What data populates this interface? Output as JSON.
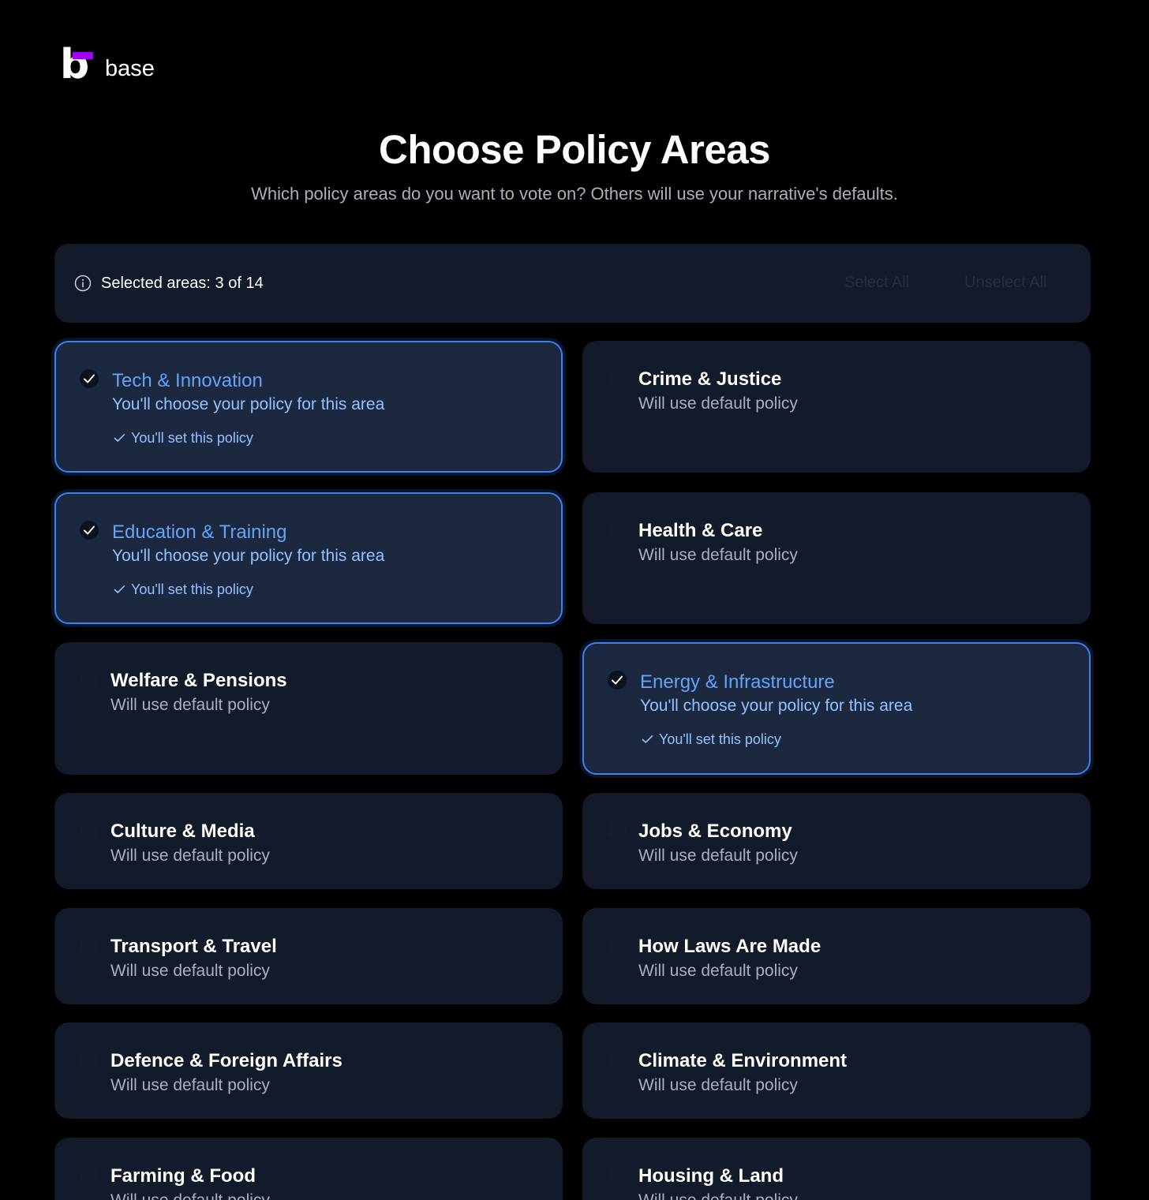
{
  "brand": {
    "name": "base",
    "accent": "#a100f2"
  },
  "header": {
    "title": "Choose Policy Areas",
    "subtitle": "Which policy areas do you want to vote on? Others will use your narrative's defaults."
  },
  "selection_bar": {
    "label": "Selected areas: 3 of 14",
    "selected_count": 3,
    "total": 14,
    "select_all_label": "Select All",
    "unselect_all_label": "Unselect All",
    "icon": "info-icon"
  },
  "colors": {
    "background": "#000000",
    "card": "#131a2a",
    "card_selected": "#1c2740",
    "selected_border": "#3e80ec",
    "selected_title": "#65a4f5"
  },
  "areas": [
    {
      "name": "Tech & Innovation",
      "status": "You'll choose your policy for this area",
      "note": "You'll set this policy",
      "selected": true
    },
    {
      "name": "Crime & Justice",
      "status": "Will use default policy",
      "selected": false
    },
    {
      "name": "Education & Training",
      "status": "You'll choose your policy for this area",
      "note": "You'll set this policy",
      "selected": true
    },
    {
      "name": "Health & Care",
      "status": "Will use default policy",
      "selected": false
    },
    {
      "name": "Welfare & Pensions",
      "status": "Will use default policy",
      "selected": false
    },
    {
      "name": "Energy & Infrastructure",
      "status": "You'll choose your policy for this area",
      "note": "You'll set this policy",
      "selected": true
    },
    {
      "name": "Culture & Media",
      "status": "Will use default policy",
      "selected": false
    },
    {
      "name": "Jobs & Economy",
      "status": "Will use default policy",
      "selected": false
    },
    {
      "name": "Transport & Travel",
      "status": "Will use default policy",
      "selected": false
    },
    {
      "name": "How Laws Are Made",
      "status": "Will use default policy",
      "selected": false
    },
    {
      "name": "Defence & Foreign Affairs",
      "status": "Will use default policy",
      "selected": false
    },
    {
      "name": "Climate & Environment",
      "status": "Will use default policy",
      "selected": false
    },
    {
      "name": "Farming & Food",
      "status": "Will use default policy",
      "selected": false
    },
    {
      "name": "Housing & Land",
      "status": "Will use default policy",
      "selected": false
    }
  ]
}
